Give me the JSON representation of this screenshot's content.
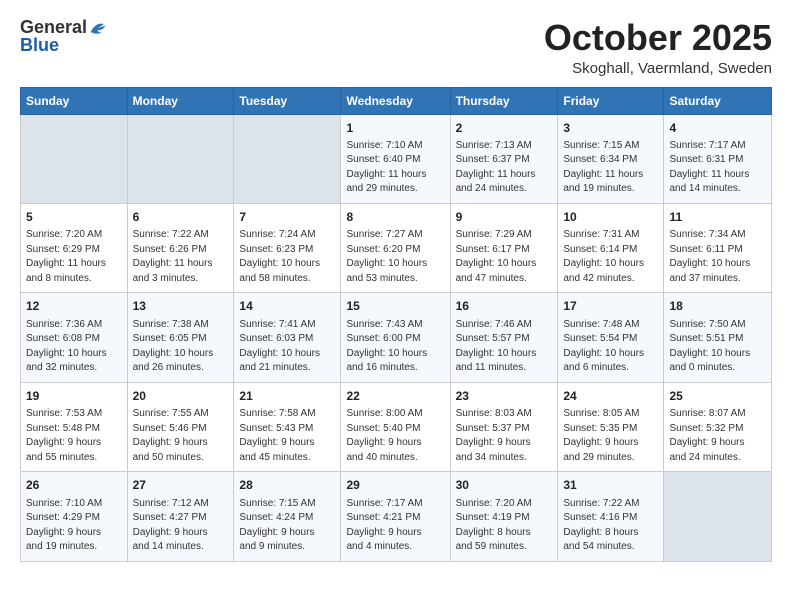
{
  "header": {
    "logo_general": "General",
    "logo_blue": "Blue",
    "month": "October 2025",
    "location": "Skoghall, Vaermland, Sweden"
  },
  "days_of_week": [
    "Sunday",
    "Monday",
    "Tuesday",
    "Wednesday",
    "Thursday",
    "Friday",
    "Saturday"
  ],
  "weeks": [
    [
      {
        "day": "",
        "info": ""
      },
      {
        "day": "",
        "info": ""
      },
      {
        "day": "",
        "info": ""
      },
      {
        "day": "1",
        "info": "Sunrise: 7:10 AM\nSunset: 6:40 PM\nDaylight: 11 hours\nand 29 minutes."
      },
      {
        "day": "2",
        "info": "Sunrise: 7:13 AM\nSunset: 6:37 PM\nDaylight: 11 hours\nand 24 minutes."
      },
      {
        "day": "3",
        "info": "Sunrise: 7:15 AM\nSunset: 6:34 PM\nDaylight: 11 hours\nand 19 minutes."
      },
      {
        "day": "4",
        "info": "Sunrise: 7:17 AM\nSunset: 6:31 PM\nDaylight: 11 hours\nand 14 minutes."
      }
    ],
    [
      {
        "day": "5",
        "info": "Sunrise: 7:20 AM\nSunset: 6:29 PM\nDaylight: 11 hours\nand 8 minutes."
      },
      {
        "day": "6",
        "info": "Sunrise: 7:22 AM\nSunset: 6:26 PM\nDaylight: 11 hours\nand 3 minutes."
      },
      {
        "day": "7",
        "info": "Sunrise: 7:24 AM\nSunset: 6:23 PM\nDaylight: 10 hours\nand 58 minutes."
      },
      {
        "day": "8",
        "info": "Sunrise: 7:27 AM\nSunset: 6:20 PM\nDaylight: 10 hours\nand 53 minutes."
      },
      {
        "day": "9",
        "info": "Sunrise: 7:29 AM\nSunset: 6:17 PM\nDaylight: 10 hours\nand 47 minutes."
      },
      {
        "day": "10",
        "info": "Sunrise: 7:31 AM\nSunset: 6:14 PM\nDaylight: 10 hours\nand 42 minutes."
      },
      {
        "day": "11",
        "info": "Sunrise: 7:34 AM\nSunset: 6:11 PM\nDaylight: 10 hours\nand 37 minutes."
      }
    ],
    [
      {
        "day": "12",
        "info": "Sunrise: 7:36 AM\nSunset: 6:08 PM\nDaylight: 10 hours\nand 32 minutes."
      },
      {
        "day": "13",
        "info": "Sunrise: 7:38 AM\nSunset: 6:05 PM\nDaylight: 10 hours\nand 26 minutes."
      },
      {
        "day": "14",
        "info": "Sunrise: 7:41 AM\nSunset: 6:03 PM\nDaylight: 10 hours\nand 21 minutes."
      },
      {
        "day": "15",
        "info": "Sunrise: 7:43 AM\nSunset: 6:00 PM\nDaylight: 10 hours\nand 16 minutes."
      },
      {
        "day": "16",
        "info": "Sunrise: 7:46 AM\nSunset: 5:57 PM\nDaylight: 10 hours\nand 11 minutes."
      },
      {
        "day": "17",
        "info": "Sunrise: 7:48 AM\nSunset: 5:54 PM\nDaylight: 10 hours\nand 6 minutes."
      },
      {
        "day": "18",
        "info": "Sunrise: 7:50 AM\nSunset: 5:51 PM\nDaylight: 10 hours\nand 0 minutes."
      }
    ],
    [
      {
        "day": "19",
        "info": "Sunrise: 7:53 AM\nSunset: 5:48 PM\nDaylight: 9 hours\nand 55 minutes."
      },
      {
        "day": "20",
        "info": "Sunrise: 7:55 AM\nSunset: 5:46 PM\nDaylight: 9 hours\nand 50 minutes."
      },
      {
        "day": "21",
        "info": "Sunrise: 7:58 AM\nSunset: 5:43 PM\nDaylight: 9 hours\nand 45 minutes."
      },
      {
        "day": "22",
        "info": "Sunrise: 8:00 AM\nSunset: 5:40 PM\nDaylight: 9 hours\nand 40 minutes."
      },
      {
        "day": "23",
        "info": "Sunrise: 8:03 AM\nSunset: 5:37 PM\nDaylight: 9 hours\nand 34 minutes."
      },
      {
        "day": "24",
        "info": "Sunrise: 8:05 AM\nSunset: 5:35 PM\nDaylight: 9 hours\nand 29 minutes."
      },
      {
        "day": "25",
        "info": "Sunrise: 8:07 AM\nSunset: 5:32 PM\nDaylight: 9 hours\nand 24 minutes."
      }
    ],
    [
      {
        "day": "26",
        "info": "Sunrise: 7:10 AM\nSunset: 4:29 PM\nDaylight: 9 hours\nand 19 minutes."
      },
      {
        "day": "27",
        "info": "Sunrise: 7:12 AM\nSunset: 4:27 PM\nDaylight: 9 hours\nand 14 minutes."
      },
      {
        "day": "28",
        "info": "Sunrise: 7:15 AM\nSunset: 4:24 PM\nDaylight: 9 hours\nand 9 minutes."
      },
      {
        "day": "29",
        "info": "Sunrise: 7:17 AM\nSunset: 4:21 PM\nDaylight: 9 hours\nand 4 minutes."
      },
      {
        "day": "30",
        "info": "Sunrise: 7:20 AM\nSunset: 4:19 PM\nDaylight: 8 hours\nand 59 minutes."
      },
      {
        "day": "31",
        "info": "Sunrise: 7:22 AM\nSunset: 4:16 PM\nDaylight: 8 hours\nand 54 minutes."
      },
      {
        "day": "",
        "info": ""
      }
    ]
  ]
}
